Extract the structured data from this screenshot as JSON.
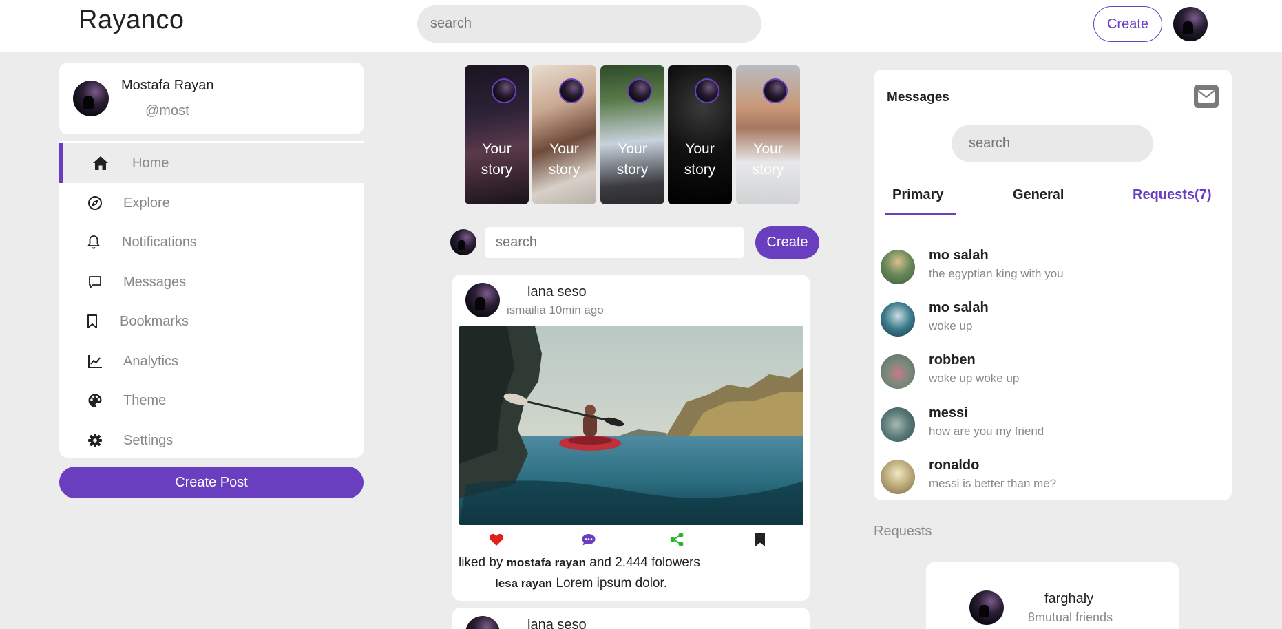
{
  "app": {
    "brand": "Rayanco",
    "search_placeholder": "search",
    "create_label": "Create"
  },
  "profile": {
    "name": "Mostafa Rayan",
    "handle": "@most"
  },
  "sidebar": {
    "items": [
      {
        "label": "Home",
        "icon": "home-icon",
        "active": true
      },
      {
        "label": "Explore",
        "icon": "compass-icon",
        "active": false
      },
      {
        "label": "Notifications",
        "icon": "bell-icon",
        "active": false
      },
      {
        "label": "Messages",
        "icon": "chat-icon",
        "active": false
      },
      {
        "label": "Bookmarks",
        "icon": "bookmark-icon",
        "active": false
      },
      {
        "label": "Analytics",
        "icon": "chart-line-icon",
        "active": false
      },
      {
        "label": "Theme",
        "icon": "palette-icon",
        "active": false
      },
      {
        "label": "Settings",
        "icon": "gear-icon",
        "active": false
      }
    ],
    "create_post_label": "Create Post"
  },
  "stories": [
    {
      "line1": "Your",
      "line2": "story"
    },
    {
      "line1": "Your",
      "line2": "story"
    },
    {
      "line1": "Your",
      "line2": "story"
    },
    {
      "line1": "Your",
      "line2": "story"
    },
    {
      "line1": "Your",
      "line2": "story"
    }
  ],
  "composer": {
    "placeholder": "search",
    "create_label": "Create"
  },
  "feed": {
    "posts": [
      {
        "author": "lana seso",
        "meta": "ismailia 10min ago",
        "likes_prefix": "liked by",
        "liked_by": "mostafa rayan",
        "likes_suffix": "and 2.444 folowers",
        "caption_author": "lesa rayan",
        "caption": "Lorem ipsum dolor."
      },
      {
        "author": "lana seso"
      }
    ]
  },
  "colors": {
    "accent": "#6a3fbf",
    "like": "#e0201a",
    "comment": "#6a3fbf",
    "share": "#2bb52b",
    "background": "#ececec"
  },
  "messages": {
    "title": "Messages",
    "search_placeholder": "search",
    "tabs": [
      {
        "label": "Primary"
      },
      {
        "label": "General"
      },
      {
        "label": "Requests(7)"
      }
    ],
    "items": [
      {
        "name": "mo salah",
        "text": "the egyptian king with you"
      },
      {
        "name": "mo salah",
        "text": "woke up"
      },
      {
        "name": "robben",
        "text": "woke up woke up"
      },
      {
        "name": "messi",
        "text": "how are you my friend"
      },
      {
        "name": "ronaldo",
        "text": "messi is better than me?"
      }
    ]
  },
  "requests": {
    "title": "Requests",
    "items": [
      {
        "name": "farghaly",
        "mutual": "8mutual friends"
      }
    ]
  }
}
